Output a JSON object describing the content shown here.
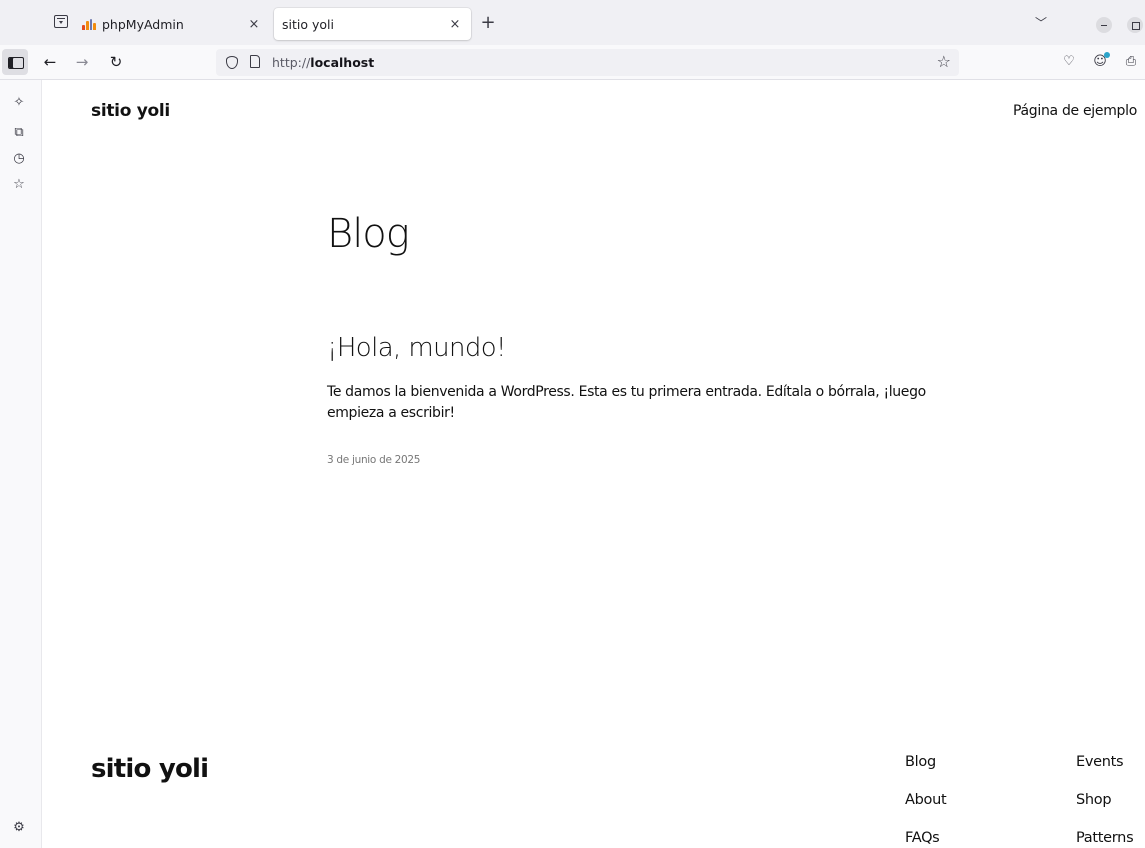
{
  "browser": {
    "tabs": [
      {
        "title": "phpMyAdmin",
        "active": false
      },
      {
        "title": "sitio yoli",
        "active": true
      }
    ],
    "close_glyph": "×",
    "new_tab_glyph": "+",
    "tabs_menu_glyph": "﹀",
    "url": {
      "scheme": "http://",
      "host": "localhost"
    }
  },
  "site": {
    "title": "sitio yoli",
    "header_nav": [
      "Página de ejemplo"
    ],
    "page_heading": "Blog",
    "posts": [
      {
        "title": "¡Hola, mundo!",
        "excerpt": "Te damos la bienvenida a WordPress. Esta es tu primera entrada. Edítala o bórrala, ¡luego empieza a escribir!",
        "date": "3 de junio de 2025"
      }
    ],
    "footer": {
      "title": "sitio yoli",
      "nav_col_1": [
        "Blog",
        "About",
        "FAQs"
      ],
      "nav_col_2": [
        "Events",
        "Shop",
        "Patterns"
      ]
    }
  },
  "colors": {
    "tab_strip": "#f0f0f4",
    "active_tab": "#ffffff",
    "text": "#111111",
    "muted": "#777777"
  }
}
